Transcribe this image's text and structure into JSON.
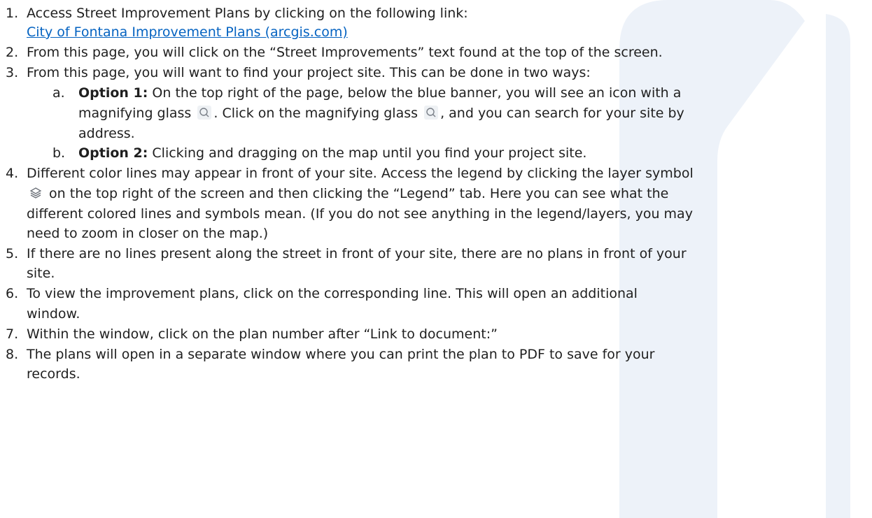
{
  "colors": {
    "link": "#0563c1",
    "text": "#1f1f1f",
    "watermark": "#edf2f9"
  },
  "steps": {
    "s1": {
      "num": "1.",
      "text": "Access Street Improvement Plans by clicking on the following link:",
      "link": "City of Fontana Improvement Plans (arcgis.com)"
    },
    "s2": {
      "num": "2.",
      "text": "From this page, you will click on the “Street Improvements” text found at the top of the screen."
    },
    "s3": {
      "num": "3.",
      "text": "From this page, you will want to find your project site. This can be done in two ways:",
      "a": {
        "letter": "a.",
        "label": "Option 1:",
        "text1": " On the top right of the page, below the blue banner, you will see an icon with a",
        "text2a": "magnifying glass ",
        "text2b": ". Click on the magnifying glass ",
        "text2c": ", and you can search for your site by",
        "text3": "address."
      },
      "b": {
        "letter": "b.",
        "label": "Option 2:",
        "text": " Clicking and dragging on the map until you find your project site."
      }
    },
    "s4": {
      "num": "4.",
      "line1": "Different color lines may appear in front of your site. Access the legend by clicking the layer symbol",
      "line2": " on the top right of the screen and then clicking the “Legend” tab. Here you can see what the",
      "line3": "different colored lines and symbols mean. (If you do not see anything in the legend/layers, you may",
      "line4": "need to zoom in closer on the map.)"
    },
    "s5": {
      "num": "5.",
      "line1": "If there are no lines present along the street in front of your site, there are no plans in front of your",
      "line2": "site."
    },
    "s6": {
      "num": "6.",
      "line1": "To view the improvement plans, click on the corresponding line. This will open an additional",
      "line2": "window."
    },
    "s7": {
      "num": "7.",
      "text": "Within the window, click on the plan number after “Link to document:”"
    },
    "s8": {
      "num": "8.",
      "line1": "The plans will open in a separate window where you can print the plan to PDF to save for your",
      "line2": "records."
    }
  }
}
